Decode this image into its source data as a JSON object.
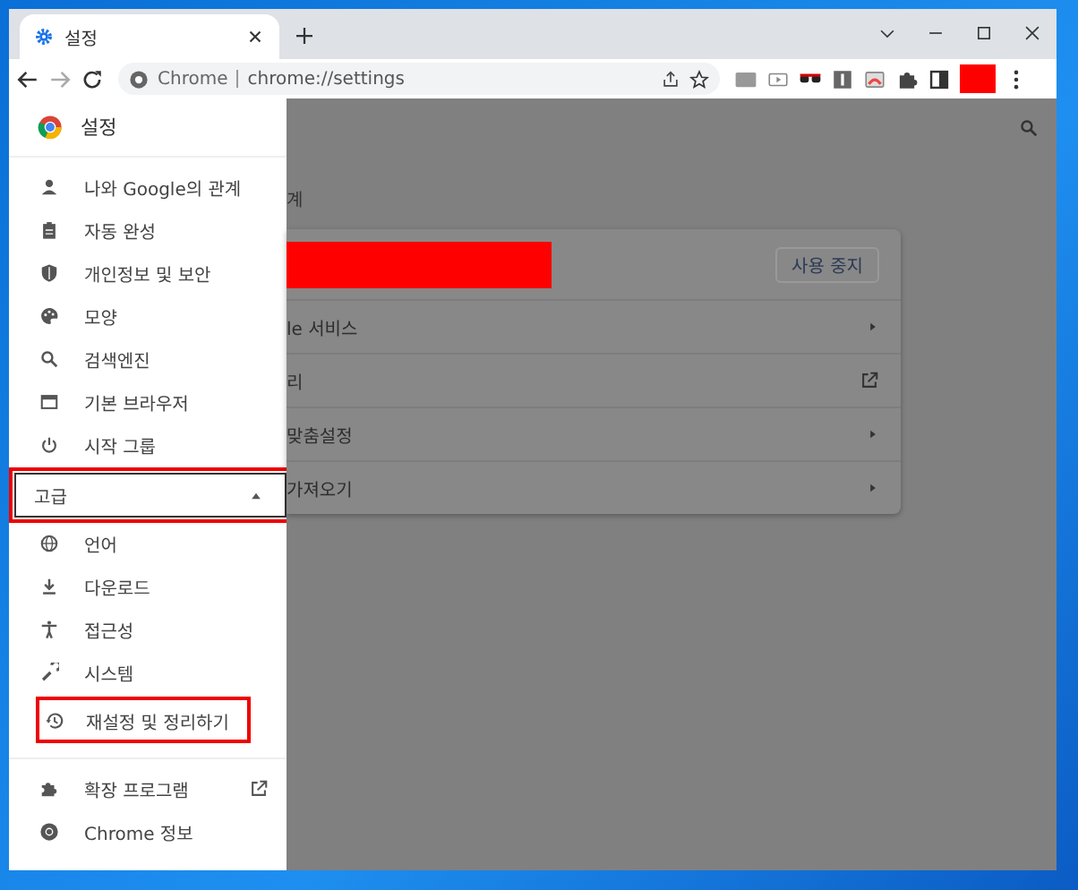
{
  "window": {
    "tab_title": "설정",
    "address_site": "Chrome",
    "address_url": "chrome://settings"
  },
  "sidebar": {
    "title": "설정",
    "items": [
      {
        "label": "나와 Google의 관계"
      },
      {
        "label": "자동 완성"
      },
      {
        "label": "개인정보 및 보안"
      },
      {
        "label": "모양"
      },
      {
        "label": "검색엔진"
      },
      {
        "label": "기본 브라우저"
      },
      {
        "label": "시작 그룹"
      }
    ],
    "advanced": {
      "label": "고급",
      "expanded": true,
      "highlighted": true
    },
    "advanced_items": [
      {
        "label": "언어",
        "highlighted": false
      },
      {
        "label": "다운로드",
        "highlighted": false
      },
      {
        "label": "접근성",
        "highlighted": false
      },
      {
        "label": "시스템",
        "highlighted": false
      },
      {
        "label": "재설정 및 정리하기",
        "highlighted": true
      }
    ],
    "footer_items": [
      {
        "label": "확장 프로그램",
        "kind": "external"
      },
      {
        "label": "Chrome 정보",
        "kind": "plain"
      }
    ]
  },
  "content": {
    "section_title": "계",
    "rows": [
      {
        "kind": "account",
        "button": "사용 중지"
      },
      {
        "kind": "submenu",
        "label": "le 서비스"
      },
      {
        "kind": "external",
        "label": "리"
      },
      {
        "kind": "submenu",
        "label": "맞춤설정"
      },
      {
        "kind": "submenu",
        "label": "가져오기"
      }
    ]
  }
}
